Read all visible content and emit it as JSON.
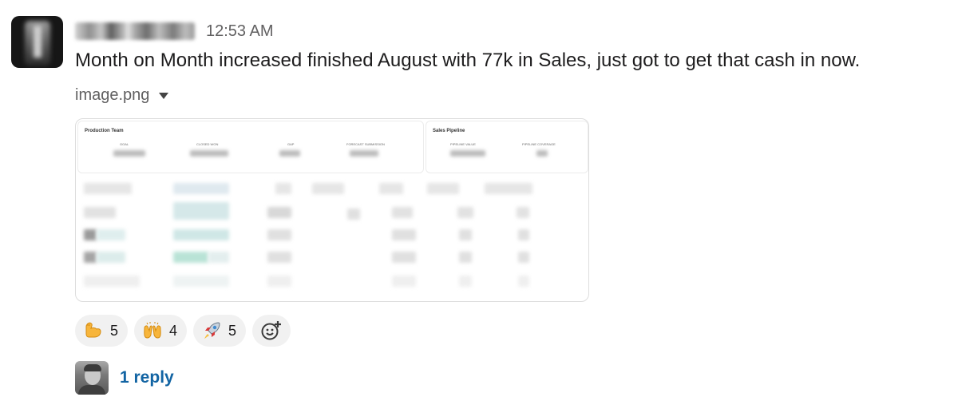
{
  "message": {
    "timestamp": "12:53 AM",
    "text": "Month on Month increased finished August with 77k in Sales, just got to get that cash in now."
  },
  "attachment": {
    "filename": "image.png",
    "preview": {
      "left_panel_title": "Production Team",
      "left_columns": [
        "GOAL",
        "CLOSED WON",
        "GAP",
        "FORECAST SUBMISSION"
      ],
      "right_panel_title": "Sales Pipeline",
      "right_columns": [
        "PIPELINE VALUE",
        "PIPELINE COVERAGE"
      ]
    }
  },
  "reactions": [
    {
      "icon": "flexed-biceps-icon",
      "count": "5"
    },
    {
      "icon": "raising-hands-icon",
      "count": "4"
    },
    {
      "icon": "rocket-icon",
      "count": "5"
    }
  ],
  "reply": {
    "label": "1 reply"
  },
  "colors": {
    "link": "#1264a3",
    "muted": "#616061",
    "text": "#1d1c1d",
    "reaction_bg": "#f1f1f1"
  }
}
